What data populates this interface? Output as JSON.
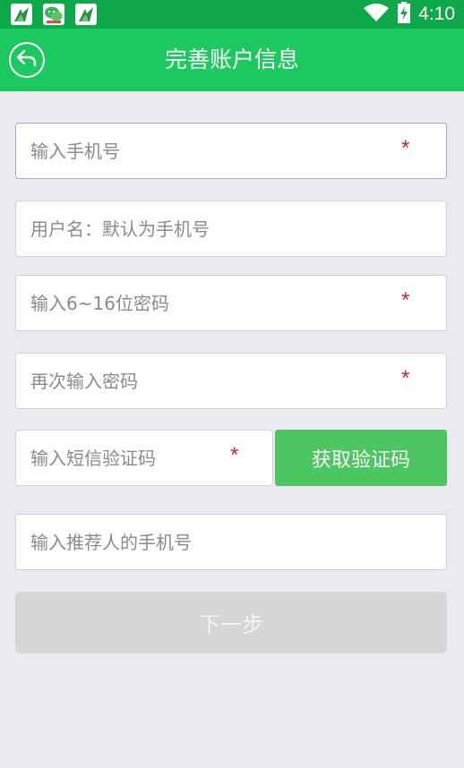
{
  "status_bar": {
    "time": "4:10",
    "notification_icons": [
      "app-notification-icon",
      "wechat-icon",
      "app-notification-icon"
    ],
    "system_icons": [
      "wifi-icon",
      "battery-charging-icon"
    ]
  },
  "header": {
    "title": "完善账户信息",
    "back_icon": "back-arrow-icon"
  },
  "form": {
    "phone": {
      "placeholder": "输入手机号",
      "value": "",
      "required_mark": "*"
    },
    "username": {
      "placeholder": "用户名：默认为手机号",
      "value": ""
    },
    "password": {
      "placeholder": "输入6~16位密码",
      "value": "",
      "required_mark": "*"
    },
    "confirm_password": {
      "placeholder": "再次输入密码",
      "value": "",
      "required_mark": "*"
    },
    "sms_code": {
      "placeholder": "输入短信验证码",
      "value": "",
      "required_mark": "*"
    },
    "get_code_label": "获取验证码",
    "referrer": {
      "placeholder": "输入推荐人的手机号",
      "value": ""
    },
    "next_label": "下一步"
  },
  "colors": {
    "status_bar": "#0ea84a",
    "title_bar": "#1cc95e",
    "get_code_button": "#4cc660",
    "next_button_disabled": "#d6d6d6",
    "required_mark": "#c9282d",
    "page_background": "#e9e9ee"
  }
}
